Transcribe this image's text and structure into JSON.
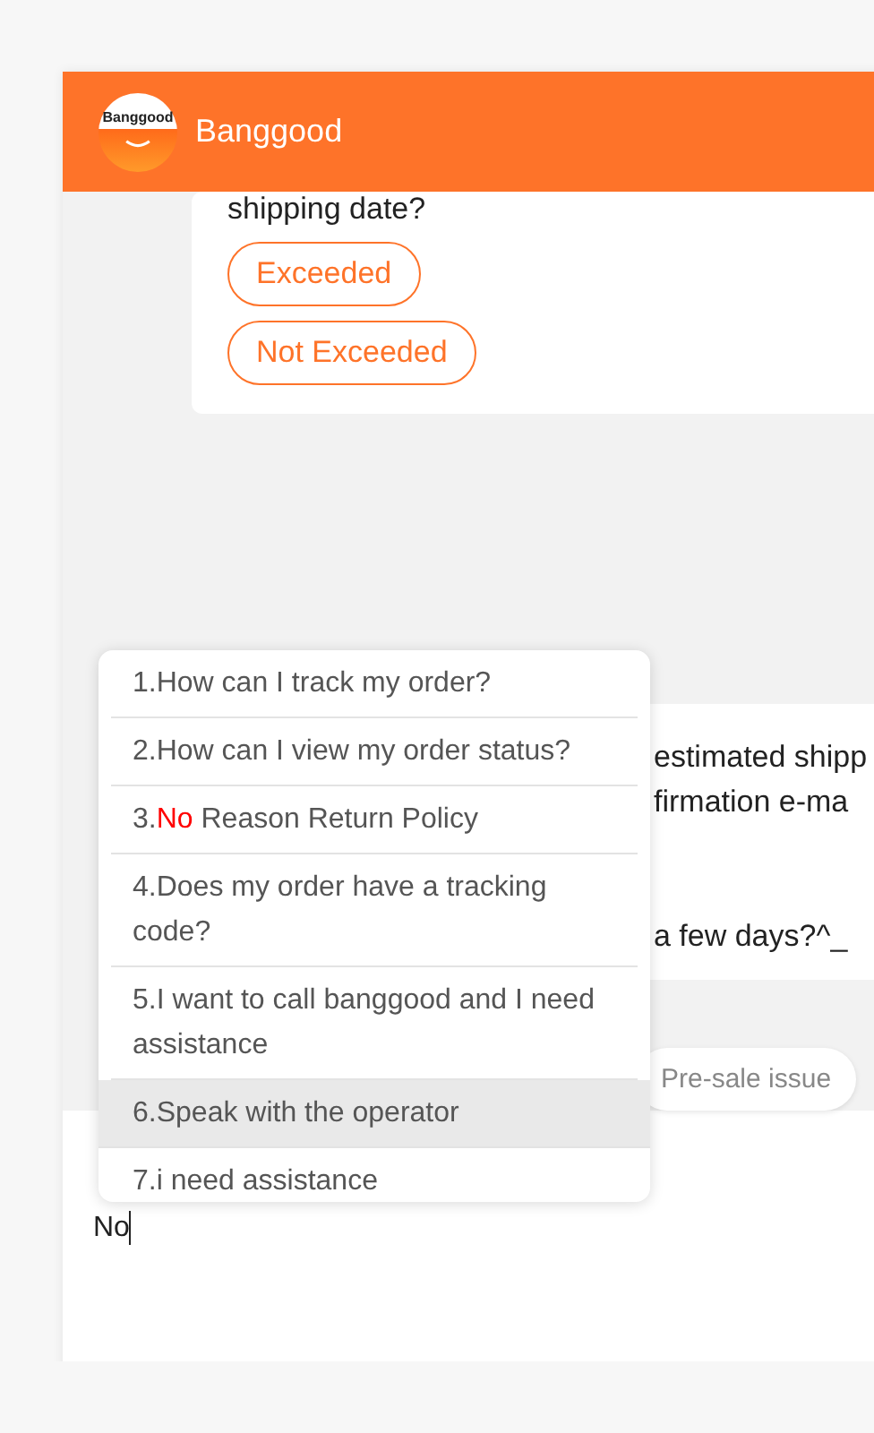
{
  "header": {
    "logo_text": "Banggood",
    "title": "Banggood"
  },
  "messages": [
    {
      "lines": [
        "shipping date?"
      ],
      "options": [
        "Exceeded",
        "Not Exceeded"
      ]
    },
    {
      "lines": [
        "estimated shipp",
        "firmation e-ma",
        "a few days?^_"
      ]
    }
  ],
  "quick_replies": [
    "Pre-sale issue"
  ],
  "suggestions": [
    {
      "segments": [
        {
          "text": "1.How can I track my order?",
          "match": false
        }
      ],
      "selected": false
    },
    {
      "segments": [
        {
          "text": "2.How can I view my order status?",
          "match": false
        }
      ],
      "selected": false
    },
    {
      "segments": [
        {
          "text": "3.",
          "match": false
        },
        {
          "text": "No",
          "match": true
        },
        {
          "text": " Reason Return Policy",
          "match": false
        }
      ],
      "selected": false
    },
    {
      "segments": [
        {
          "text": "4.Does my order have a tracking code?",
          "match": false
        }
      ],
      "selected": false
    },
    {
      "segments": [
        {
          "text": "5.I want to call banggood and I need assistance",
          "match": false
        }
      ],
      "selected": false
    },
    {
      "segments": [
        {
          "text": "6.Speak with the operator",
          "match": false
        }
      ],
      "selected": true
    },
    {
      "segments": [
        {
          "text": "7.i need assistance",
          "match": false
        }
      ],
      "selected": false
    }
  ],
  "input": {
    "value": "No"
  }
}
